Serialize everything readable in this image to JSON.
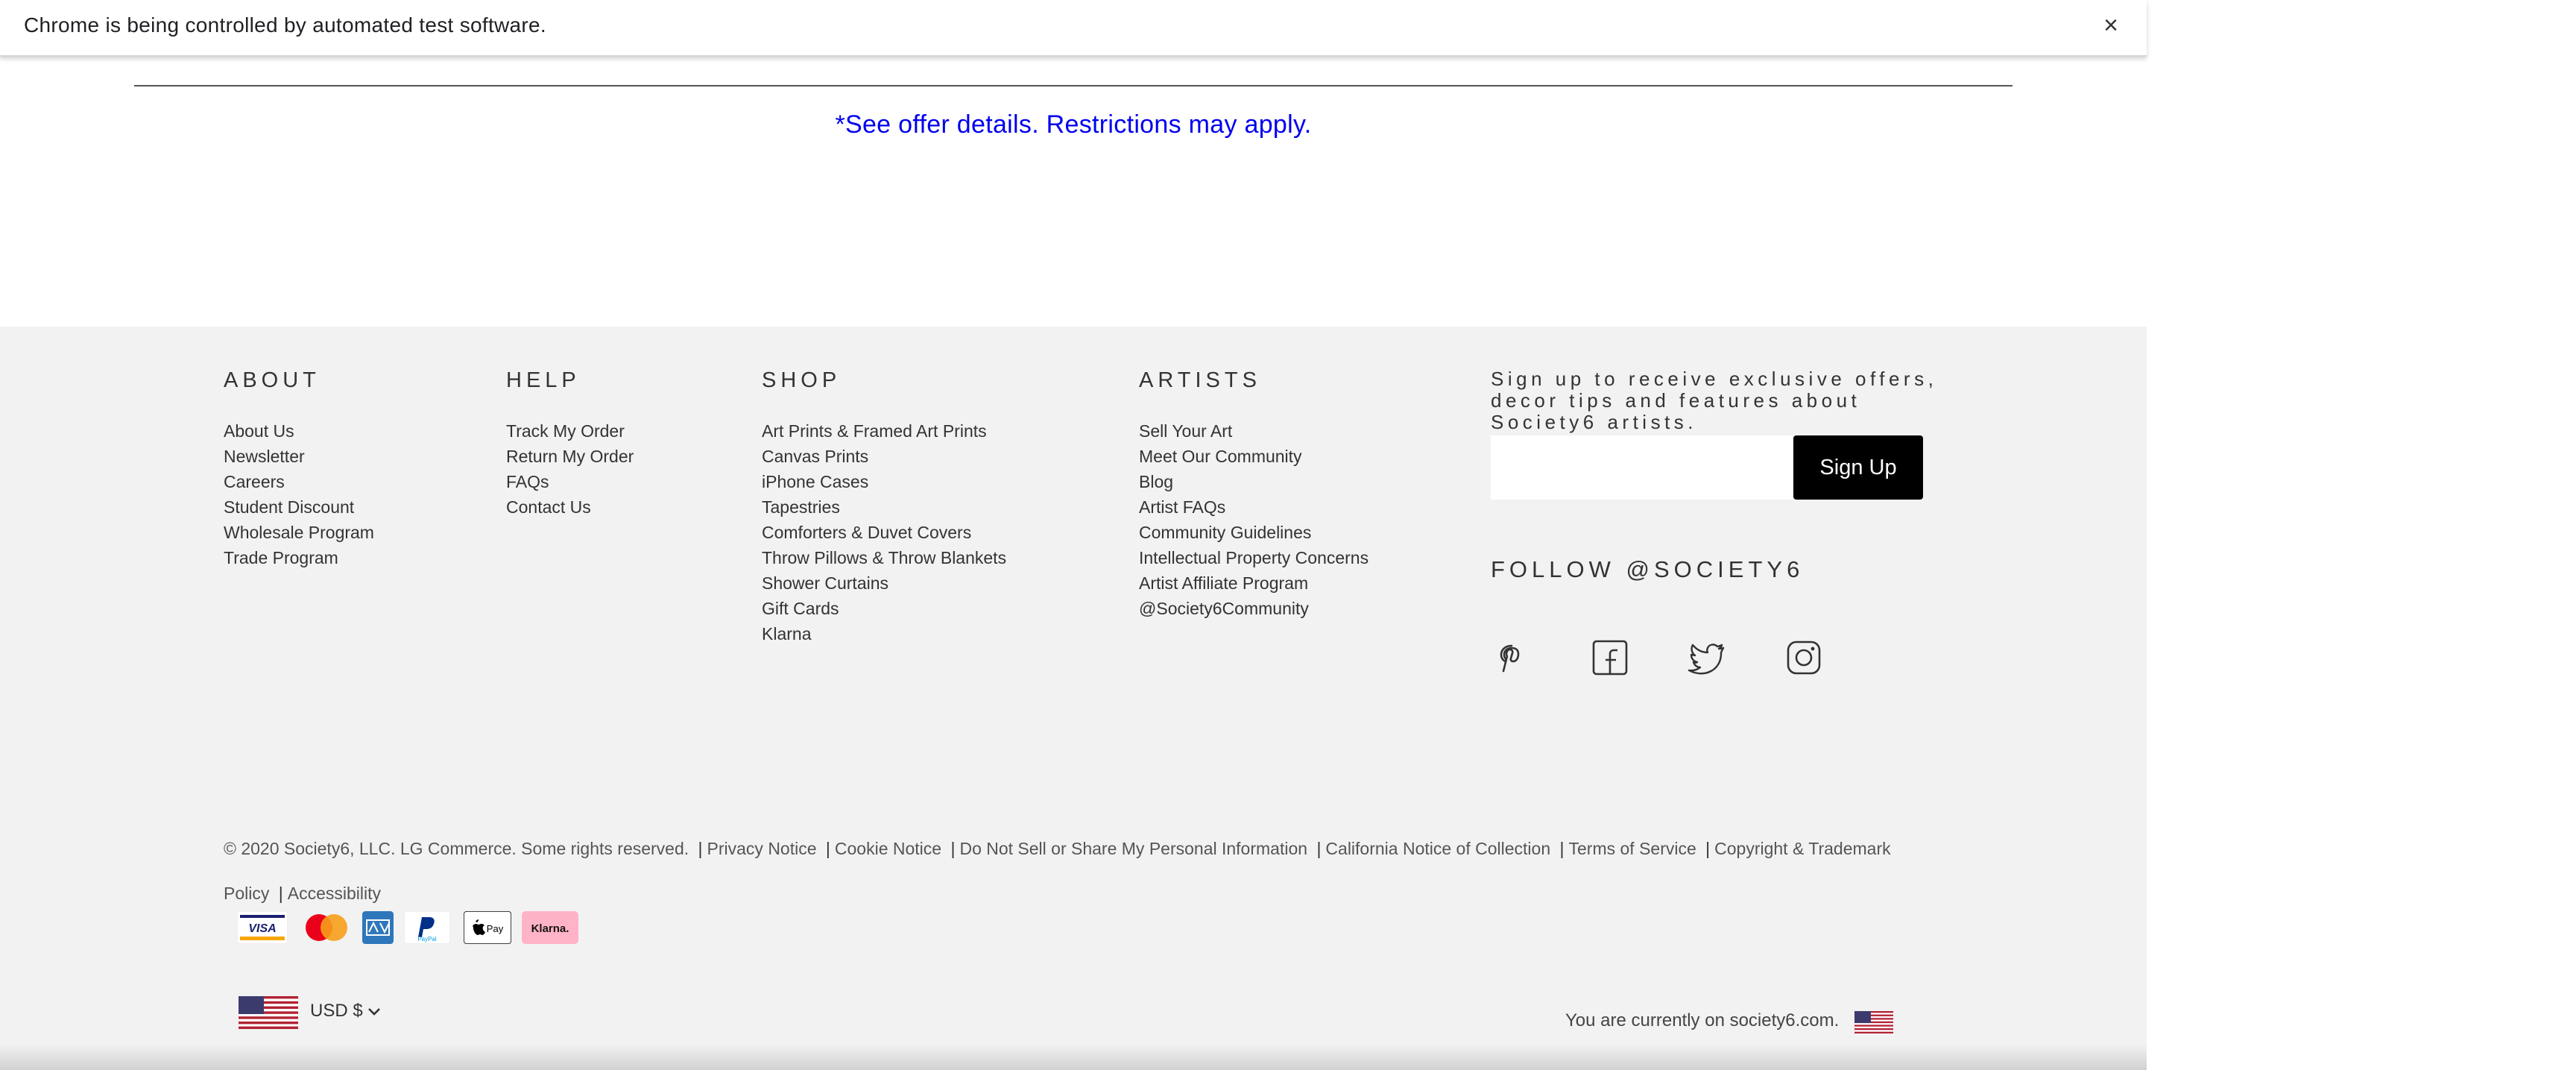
{
  "infobar": {
    "message": "Chrome is being controlled by automated test software.",
    "close": "×"
  },
  "offer": {
    "text": "*See offer details. Restrictions may apply."
  },
  "footer": {
    "about": {
      "title": "ABOUT",
      "items": [
        "About Us",
        "Newsletter",
        "Careers",
        "Student Discount",
        "Wholesale Program",
        "Trade Program"
      ]
    },
    "help": {
      "title": "HELP",
      "items": [
        "Track My Order",
        "Return My Order",
        "FAQs",
        "Contact Us"
      ]
    },
    "shop": {
      "title": "SHOP",
      "items": [
        "Art Prints & Framed Art Prints",
        "Canvas Prints",
        "iPhone Cases",
        "Tapestries",
        "Comforters & Duvet Covers",
        "Throw Pillows & Throw Blankets",
        "Shower Curtains",
        "Gift Cards",
        "Klarna"
      ]
    },
    "artists": {
      "title": "ARTISTS",
      "items": [
        "Sell Your Art",
        "Meet Our Community",
        "Blog",
        "Artist FAQs",
        "Community Guidelines",
        "Intellectual Property Concerns",
        "Artist Affiliate Program",
        "@Society6Community"
      ]
    },
    "signup": {
      "text": "Sign up to receive exclusive offers, decor tips and features about Society6 artists.",
      "placeholder": "",
      "button": "Sign Up"
    },
    "follow": {
      "title": "FOLLOW @SOCIETY6"
    },
    "social_icons": [
      "pinterest-icon",
      "facebook-icon",
      "twitter-icon",
      "instagram-icon"
    ],
    "legal": {
      "copyright": "© 2020 Society6, LLC. LG Commerce. Some rights reserved.",
      "links": [
        "Privacy Notice",
        "Cookie Notice",
        "Do Not Sell or Share My Personal Information",
        "California Notice of Collection",
        "Terms of Service",
        "Copyright & Trademark Policy",
        "Accessibility"
      ],
      "separator": "|"
    },
    "payment": {
      "visa": "VISA",
      "paypal": "PayPal",
      "applepay": "Pay",
      "klarna": "Klarna."
    },
    "currency": "USD $",
    "location_text": "You are currently on society6.com."
  },
  "colors": {
    "footer_bg": "#f2f2f2",
    "offer_link": "#0000ee",
    "signup_button": "#000000"
  }
}
